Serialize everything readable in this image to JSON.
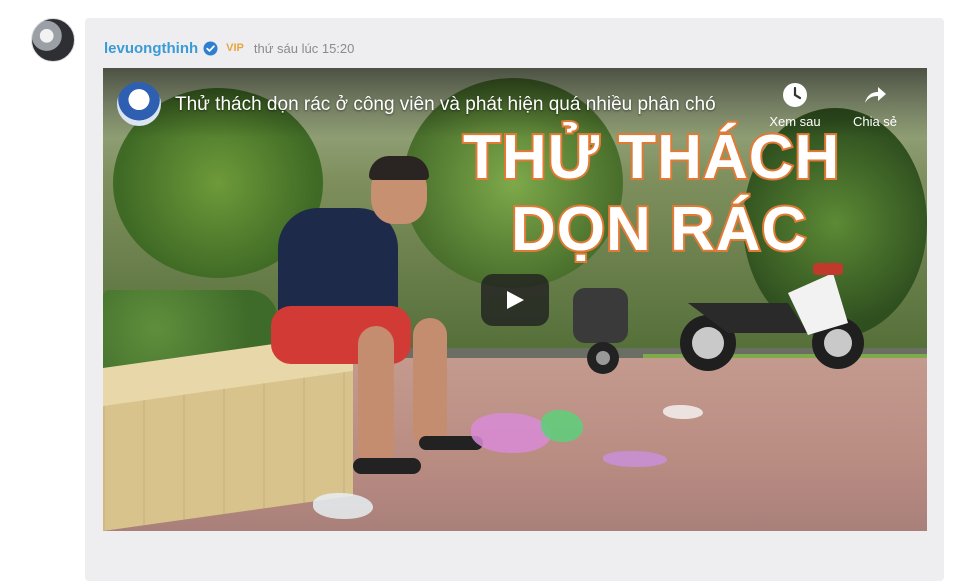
{
  "post": {
    "username": "levuongthinh",
    "badge": "VIP",
    "timestamp": "thứ sáu lúc 15:20",
    "verified_icon": "check-badge-icon",
    "colors": {
      "username": "#3a9bd5",
      "badge": "#e8a53c",
      "card_bg": "#eeeef1"
    }
  },
  "video": {
    "title": "Thử thách dọn rác ở công viên và phát hiện quá nhiều phân chó",
    "overlay_line1": "THỬ THÁCH",
    "overlay_line2": "DỌN RÁC",
    "watch_later_label": "Xem sau",
    "share_label": "Chia sẻ",
    "icons": {
      "watch_later": "clock-icon",
      "share": "share-arrow-icon",
      "play": "play-icon"
    },
    "overlay_accent": "#e07a34"
  }
}
